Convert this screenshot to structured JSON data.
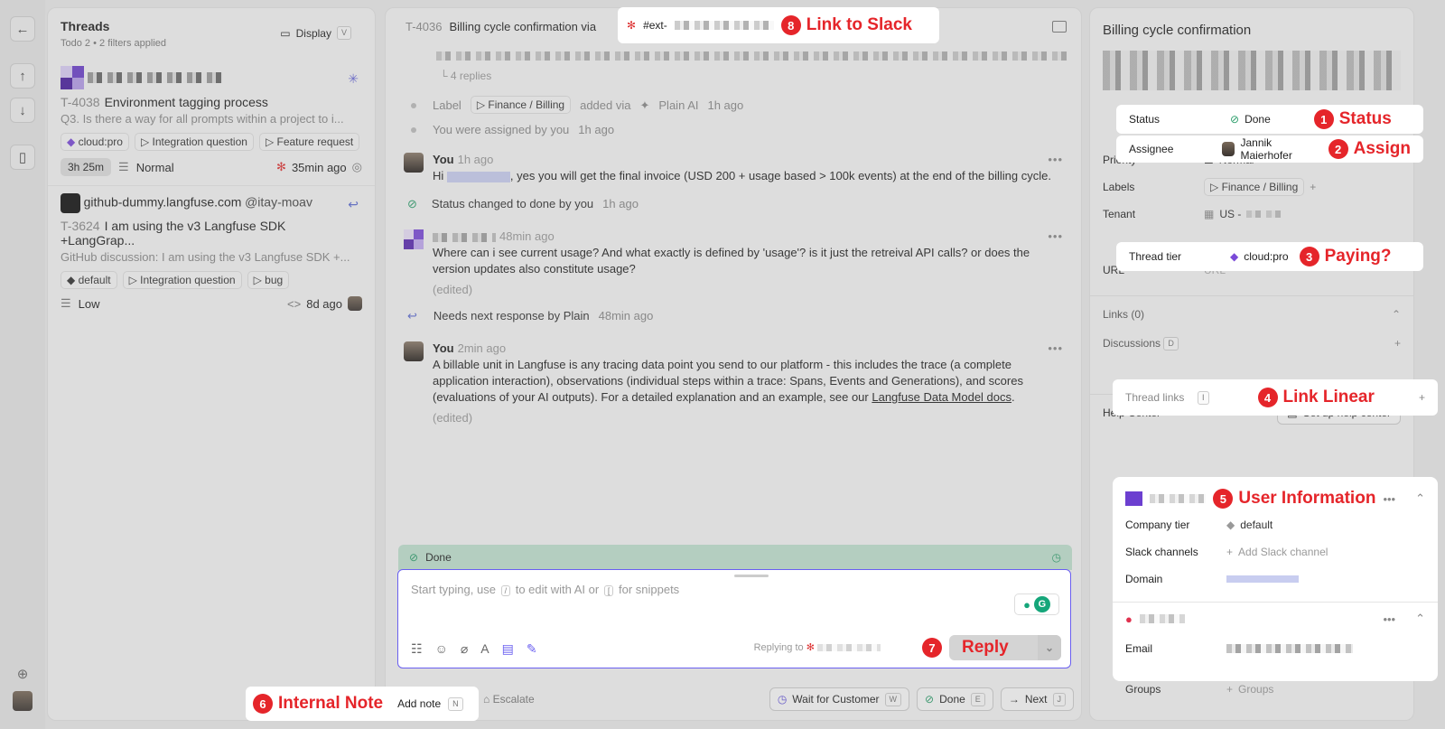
{
  "rail": {
    "back_icon": "arrow-left-icon",
    "up_icon": "arrow-up-icon",
    "down_icon": "arrow-down-icon",
    "sidebar_icon": "sidebar-icon"
  },
  "list": {
    "title": "Threads",
    "todo_label": "Todo",
    "todo_count": "2",
    "filters": "2 filters applied",
    "display_label": "Display",
    "display_key": "V",
    "threads": [
      {
        "id": "T-4038",
        "title": "Environment tagging process",
        "snippet": "Q3. Is there a way for all prompts within a project to i...",
        "tags": [
          "cloud:pro",
          "Integration question",
          "Feature request"
        ],
        "timer": "3h 25m",
        "priority": "Normal",
        "time": "35min ago"
      },
      {
        "customer": "github-dummy.langfuse.com",
        "handle": "@itay-moav",
        "id": "T-3624",
        "title": "I am using the v3 Langfuse SDK +LangGrap...",
        "snippet": "GitHub discussion: I am using the v3 Langfuse SDK +...",
        "tags": [
          "default",
          "Integration question",
          "bug"
        ],
        "priority": "Low",
        "time": "8d ago"
      }
    ]
  },
  "main": {
    "thread_id": "T-4036",
    "title": "Billing cycle confirmation via",
    "channel": "#ext-",
    "replies": "4 replies",
    "events": [
      {
        "prefix": "Label",
        "label": "Finance / Billing",
        "added_via": "added via",
        "actor": "Plain AI",
        "time": "1h ago"
      },
      {
        "text": "You were assigned by you",
        "time": "1h ago"
      }
    ],
    "messages": [
      {
        "author": "You",
        "time": "1h ago",
        "greeting": "Hi",
        "body": ", yes you will get the final invoice (USD 200 + usage based > 100k events) at the end of the billing cycle."
      },
      {
        "author": "",
        "time": "48min ago",
        "body": "Where can i see current usage? And what exactly is defined by 'usage'? is it just the retreival API calls? or does the version updates also constitute usage?",
        "edited": "(edited)"
      },
      {
        "author": "You",
        "time": "2min ago",
        "body": "A billable unit in Langfuse is any tracing data point you send to our platform - this includes the trace (a complete application interaction), observations (individual steps within a trace: Spans, Events and Generations), and scores (evaluations of your AI outputs). For a detailed explanation and an example, see our ",
        "link": "Langfuse Data Model docs",
        "edited": "(edited)"
      }
    ],
    "status_event": {
      "text": "Status changed to done by you",
      "time": "1h ago"
    },
    "next_response": {
      "text": "Needs next response by Plain",
      "time": "48min ago"
    },
    "done_label": "Done",
    "composer": {
      "ph_start": "Start typing, use",
      "key_slash": "/",
      "ph_mid": "to edit with AI or",
      "key_bracket": "[",
      "ph_end": "for snippets",
      "replying_to": "Replying to",
      "reply_label": "Reply"
    },
    "footer": {
      "add_note": "Add note",
      "add_note_key": "N",
      "escalate": "Escalate",
      "wait": "Wait for Customer",
      "wait_key": "W",
      "done": "Done",
      "done_key": "E",
      "next": "Next",
      "next_key": "J"
    }
  },
  "callouts": {
    "c1": {
      "n": "1",
      "label": "Status"
    },
    "c2": {
      "n": "2",
      "label": "Assign"
    },
    "c3": {
      "n": "3",
      "label": "Paying?"
    },
    "c4": {
      "n": "4",
      "label": "Link Linear"
    },
    "c5": {
      "n": "5",
      "label": "User Information"
    },
    "c6": {
      "n": "6",
      "label": "Internal Note"
    },
    "c7": {
      "n": "7",
      "label": "Reply"
    },
    "c8": {
      "n": "8",
      "label": "Link to Slack"
    }
  },
  "panel": {
    "title": "Billing cycle confirmation",
    "status": {
      "label": "Status",
      "value": "Done"
    },
    "assignee": {
      "label": "Assignee",
      "value": "Jannik Maierhofer"
    },
    "priority": {
      "label": "Priority",
      "value": "Normal"
    },
    "labels": {
      "label": "Labels",
      "value": "Finance / Billing"
    },
    "tenant": {
      "label": "Tenant",
      "value": "US -"
    },
    "tier": {
      "label": "Thread tier",
      "value": "cloud:pro"
    },
    "url": {
      "label": "URL",
      "value": "URL"
    },
    "links": "Links (0)",
    "discussions": "Discussions",
    "discussions_key": "D",
    "thread_links": "Thread links",
    "thread_links_key": "I",
    "help_center": "Help Center",
    "setup_help": "Set up help center",
    "company": {
      "tier_label": "Company tier",
      "tier_value": "default",
      "slack_label": "Slack channels",
      "slack_value": "Add Slack channel",
      "domain_label": "Domain"
    },
    "user": {
      "email_label": "Email",
      "groups_label": "Groups",
      "groups_value": "Groups"
    }
  },
  "colors": {
    "accent": "#6a5ff0",
    "callout": "#e5252a",
    "done_bar": "#bfe0cf"
  }
}
